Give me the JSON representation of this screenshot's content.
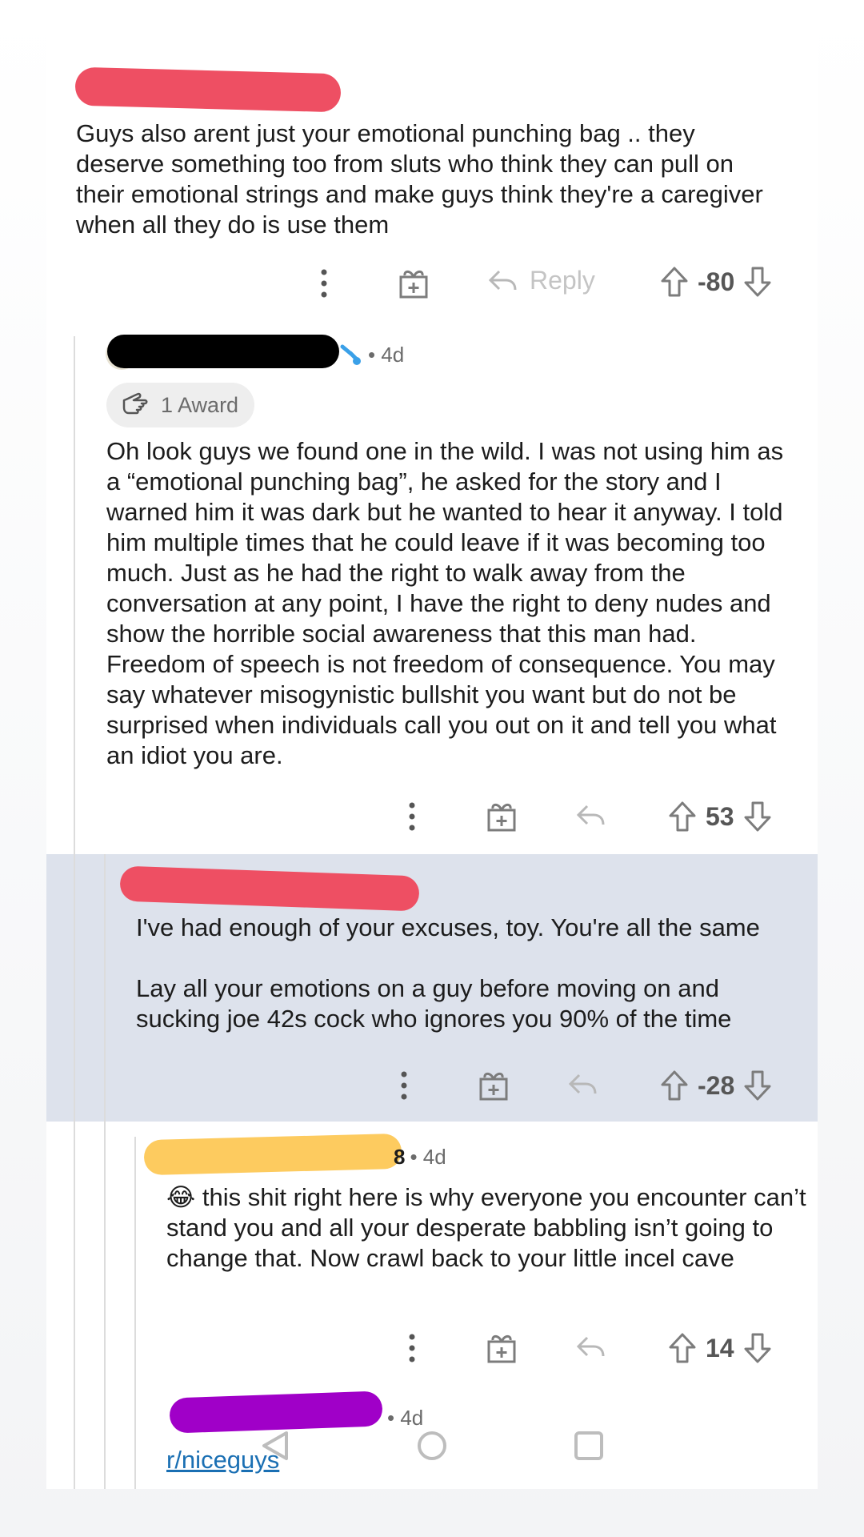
{
  "comments": [
    {
      "username": "",
      "age": "",
      "text": "Guys also arent just your emotional punching bag .. they deserve something too from sluts who think they can pull on their emotional strings and make guys think they're a caregiver when all they do is use them",
      "reply_label": "Reply",
      "score": "-80",
      "redaction_color": "#ee4f63"
    },
    {
      "username": "",
      "age": "• 4d",
      "award_label": "1 Award",
      "text": "Oh look guys we found one in the wild. I was not using him as a “emotional punching bag”, he asked for the story and I warned him it was dark but he wanted to hear it anyway. I told him multiple times that he could leave if it was becoming too much. Just as he had the right to walk away from the conversation at any point, I have the right to deny nudes and show the horrible social awareness that this man had. Freedom of speech is not freedom of consequence. You may say whatever misogynistic bullshit you want but do not be surprised when individuals call you out on it and tell you what an idiot you are.",
      "score": "53",
      "redaction_color": "#000000"
    },
    {
      "username": "",
      "age": "",
      "text": "I've had enough of your excuses, toy. You're all the same\n\nLay all your emotions on a guy before moving on and sucking joe 42s cock who ignores you 90% of the time",
      "score": "-28",
      "redaction_color": "#ee4f63",
      "highlight_color": "#dde2ec"
    },
    {
      "username_tail": "8",
      "age": "• 4d",
      "emoji": "😂",
      "text": "this shit right here is why everyone you encounter can’t stand you and all your desperate babbling isn’t going to change that. Now crawl back to your little incel cave",
      "score": "14",
      "redaction_color": "#fdcb5f"
    },
    {
      "username": "",
      "age": "• 4d",
      "link_text": "r/niceguys",
      "redaction_color": "#a000c8"
    }
  ],
  "icons": {
    "more": "more-vertical-icon",
    "award": "gift-icon",
    "reply": "reply-arrow-icon",
    "upvote": "upvote-arrow-icon",
    "downvote": "downvote-arrow-icon"
  }
}
